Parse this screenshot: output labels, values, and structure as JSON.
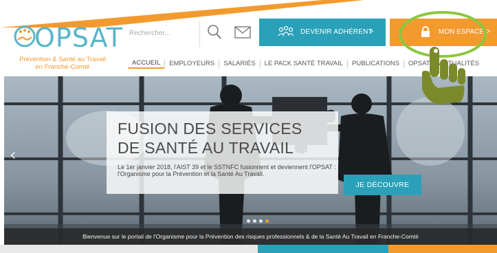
{
  "brand": {
    "logo_text": "OPSAT",
    "tagline_line1": "Prévention & Santé au Travail",
    "tagline_line2": "en Franche-Comté"
  },
  "header": {
    "search_placeholder": "Rechercher...",
    "search_icon": "magnifier-icon",
    "mail_icon": "envelope-icon",
    "adherent_label": "DEVENIR ADHÉRENT",
    "adherent_chevron": ">",
    "adherent_icon": "people-icon",
    "espace_label": "MON ESPACE",
    "espace_chevron": ">",
    "espace_icon": "lock-icon"
  },
  "nav": {
    "items": [
      {
        "label": "ACCUEIL",
        "active": true
      },
      {
        "label": "EMPLOYEURS"
      },
      {
        "label": "SALARIÉS"
      },
      {
        "label": "LE PACK SANTÉ TRAVAIL"
      },
      {
        "label": "PUBLICATIONS"
      },
      {
        "label": "OPSAT"
      },
      {
        "label": "ACTUALITÉS"
      }
    ]
  },
  "hero": {
    "title_line1": "FUSION DES SERVICES",
    "title_line2": "DE SANTÉ AU TRAVAIL",
    "text": "Le 1er janvier 2018, l'AIST 39 et le SSTNFC fusionnent et deviennent l'OPSAT : l'Organisme pour la Prévention et la Santé Au Travail.",
    "button_label": "JE DÉCOUVRE",
    "prev_arrow": "‹",
    "slides_count": 4,
    "active_slide": 4
  },
  "welcome_bar": "Bienvenue sur le portail de l'Organisme pour la Prévention des risques professionnels & de la Santé Au Travail en Franche-Comté",
  "colors": {
    "teal": "#2aa1b8",
    "orange": "#f39a2e",
    "highlight_green": "#8cc63f",
    "pointer_hand": "#7a8a2a"
  }
}
